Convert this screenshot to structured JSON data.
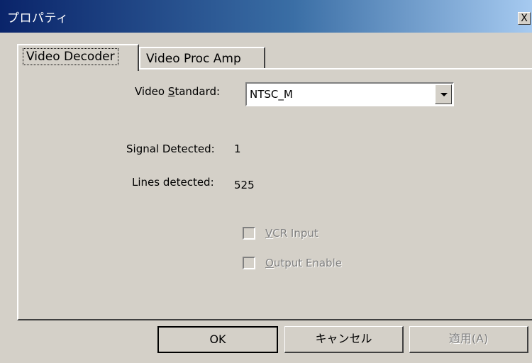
{
  "window": {
    "title": "プロパティ",
    "close_label": "X"
  },
  "tabs": [
    {
      "label": "Video Decoder",
      "active": true
    },
    {
      "label": "Video Proc Amp",
      "active": false
    }
  ],
  "form": {
    "video_standard": {
      "label": "Video Standard:",
      "mnemonic": "S",
      "value": "NTSC_M"
    },
    "signal_detected": {
      "label": "Signal Detected:",
      "value": "1"
    },
    "lines_detected": {
      "label": "Lines detected:",
      "value": "525"
    },
    "vcr_input": {
      "label": "VCR Input",
      "mnemonic": "V",
      "checked": false,
      "enabled": false
    },
    "output_enable": {
      "label": "Output Enable",
      "mnemonic": "O",
      "checked": false,
      "enabled": false
    }
  },
  "buttons": {
    "ok": "OK",
    "cancel": "キャンセル",
    "apply": "適用(A)"
  }
}
